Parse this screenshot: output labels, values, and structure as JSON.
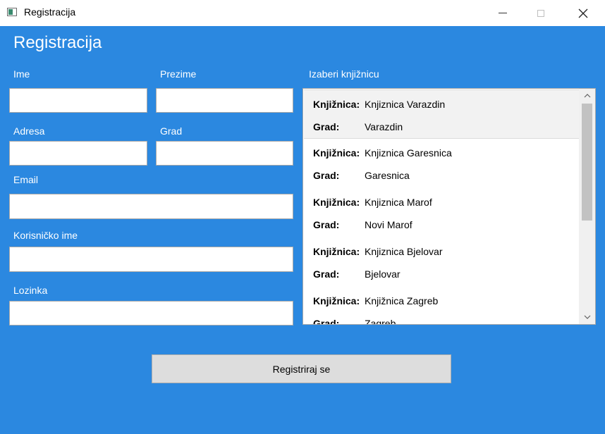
{
  "window": {
    "title": "Registracija",
    "controls": {
      "minimize": "minimize-icon",
      "maximize": "maximize-icon",
      "close": "close-icon"
    }
  },
  "form": {
    "heading": "Registracija",
    "fields": {
      "ime": {
        "label": "Ime",
        "value": ""
      },
      "prezime": {
        "label": "Prezime",
        "value": ""
      },
      "adresa": {
        "label": "Adresa",
        "value": ""
      },
      "grad": {
        "label": "Grad",
        "value": ""
      },
      "email": {
        "label": "Email",
        "value": ""
      },
      "korisnicko_ime": {
        "label": "Korisničko ime",
        "value": ""
      },
      "lozinka": {
        "label": "Lozinka",
        "value": ""
      }
    },
    "submit_label": "Registriraj se"
  },
  "libraries": {
    "label": "Izaberi knjižnicu",
    "key_library": "Knjižnica:",
    "key_city": "Grad:",
    "selected_index": 0,
    "items": [
      {
        "name": "Knjiznica Varazdin",
        "city": "Varazdin"
      },
      {
        "name": "Knjiznica Garesnica",
        "city": "Garesnica"
      },
      {
        "name": "Knjiznica Marof",
        "city": "Novi Marof"
      },
      {
        "name": "Knjiznica Bjelovar",
        "city": "Bjelovar"
      },
      {
        "name": "Knjižnica Zagreb",
        "city": "Zagreb"
      }
    ]
  },
  "colors": {
    "background": "#2b88e0",
    "selected_item": "#f2f2f2",
    "button": "#dddddd"
  }
}
